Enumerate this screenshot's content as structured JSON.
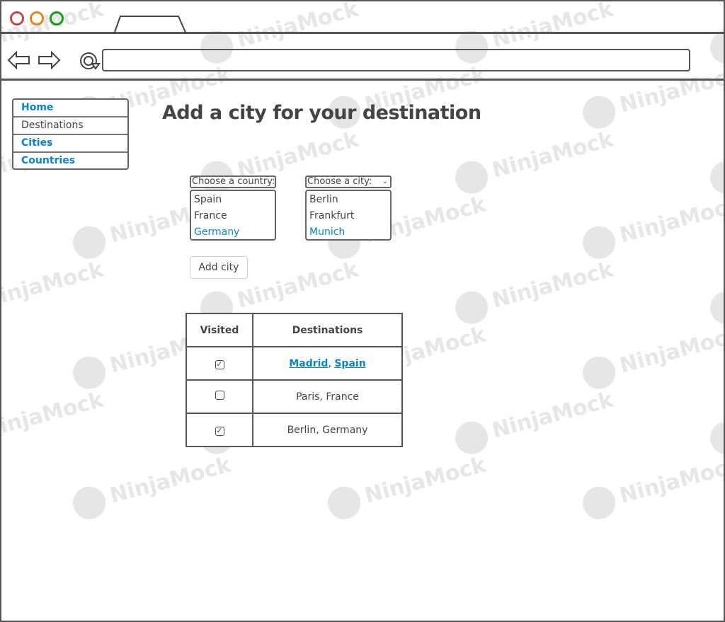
{
  "watermark": "NinjaMock",
  "browser": {
    "colors": {
      "close": "#c0474f",
      "minimize": "#e08a1e",
      "maximize": "#12a012"
    },
    "url": ""
  },
  "sidebar": {
    "items": [
      {
        "label": "Home",
        "active": false,
        "link": true
      },
      {
        "label": "Destinations",
        "active": true,
        "link": false
      },
      {
        "label": "Cities",
        "link": true
      },
      {
        "label": "Countries",
        "link": true
      }
    ]
  },
  "page": {
    "title": "Add a city for your destination"
  },
  "country_select": {
    "label": "Choose a country:",
    "options": [
      "Spain",
      "France",
      "Germany"
    ],
    "selected": "Germany"
  },
  "city_select": {
    "label": "Choose a city:",
    "options": [
      "Berlin",
      "Frankfurt",
      "Munich"
    ],
    "selected": "Munich"
  },
  "add_button": "Add city",
  "table": {
    "headers": [
      "Visited",
      "Destinations"
    ],
    "rows": [
      {
        "visited": true,
        "city": "Madrid",
        "sep": ", ",
        "country": "Spain",
        "linked": true
      },
      {
        "visited": false,
        "destination": "Paris, France"
      },
      {
        "visited": true,
        "destination": "Berlin, Germany"
      }
    ]
  },
  "accent": "#0a84cf"
}
